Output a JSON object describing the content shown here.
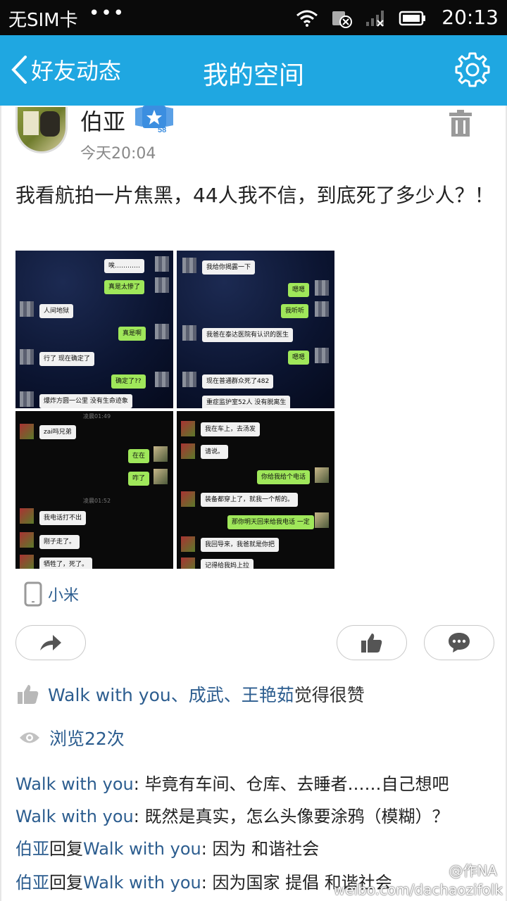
{
  "status_bar": {
    "carrier": "无SIM卡",
    "dots": "•••",
    "time": "20:13"
  },
  "title_bar": {
    "back_label": "好友动态",
    "title": "我的空间",
    "accent_color": "#1fa7e1"
  },
  "post": {
    "username": "伯亚",
    "vip_level": "58",
    "time": "今天20:04",
    "text": "我看航拍一片焦黑，44人我不信，到底死了多少人？！",
    "images": [
      {
        "bubbles": [
          "唉…………",
          "真是太惨了",
          "人间地狱",
          "真是啊",
          "行了 现在确定了",
          "确定了??",
          "爆炸方圆一公里 没有生命迹象"
        ]
      },
      {
        "bubbles": [
          "我给你揭露一下",
          "嗯嗯",
          "我听听",
          "我爸在泰达医院有认识的医生",
          "嗯嗯",
          "现在普通群众死了482",
          "重症监护室52人 没有脱离生"
        ]
      },
      {
        "stamp1": "凌晨01:49",
        "stamp2": "凌晨01:52",
        "bubbles": [
          "zai吗兄弟",
          "在在",
          "咋了",
          "我电话打不出",
          "刚子走了。",
          "牺牲了，死了。"
        ]
      },
      {
        "bubbles": [
          "我在车上，去汤发",
          "请说。",
          "你给我给个电话",
          "装备都穿上了，就我一个帮的。",
          "那你明天回来给我电话 一定",
          "我回导来，我爸就是你把",
          "记得给我妈上拉"
        ]
      }
    ],
    "device": "小米",
    "likes": {
      "names": "Walk with you、成武、王艳茹",
      "suffix": "觉得很赞"
    },
    "views": "浏览22次",
    "comments": [
      {
        "author": "Walk with you",
        "reply_word": "",
        "reply_to": "",
        "text": ": 毕竟有车间、仓库、去睡者……自己想吧"
      },
      {
        "author": "Walk with you",
        "reply_word": "",
        "reply_to": "",
        "text": ": 既然是真实，怎么头像要涂鸦（模糊）？"
      },
      {
        "author": "伯亚",
        "reply_word": "回复",
        "reply_to": "Walk with you",
        "text": ": 因为 和谐社会"
      },
      {
        "author": "伯亚",
        "reply_word": "回复",
        "reply_to": "Walk with you",
        "text": ": 因为国家 提倡 和谐社会"
      }
    ]
  },
  "watermark": {
    "site": "weibo.com/dachaozifolk",
    "handle": "@作NA"
  },
  "icons": [
    "back-arrow-icon",
    "gear-icon",
    "trash-icon",
    "vip-badge-icon",
    "phone-icon",
    "share-icon",
    "thumbs-up-icon",
    "comment-icon",
    "eye-icon"
  ]
}
